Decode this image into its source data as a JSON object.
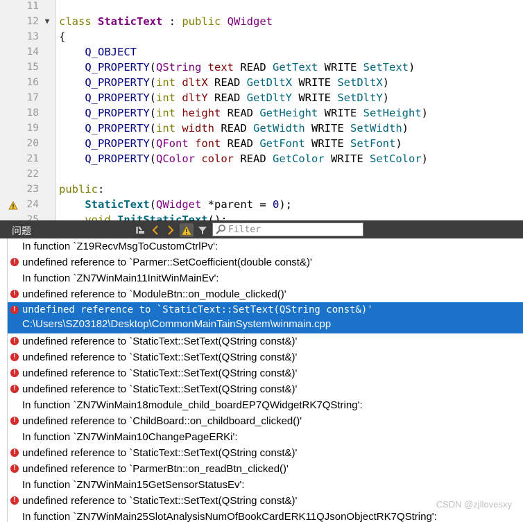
{
  "editor": {
    "lines": [
      {
        "n": "11",
        "tokens": []
      },
      {
        "n": "12",
        "fold": "▼",
        "tokens": [
          [
            "t-kw",
            "class "
          ],
          [
            "t-cls",
            "StaticText"
          ],
          [
            "t-plain",
            " : "
          ],
          [
            "t-kw",
            "public "
          ],
          [
            "t-type",
            "QWidget"
          ]
        ]
      },
      {
        "n": "13",
        "tokens": [
          [
            "t-punc",
            "{"
          ]
        ]
      },
      {
        "n": "14",
        "tokens": [
          [
            "t-plain",
            "    "
          ],
          [
            "t-macro",
            "Q_OBJECT"
          ]
        ]
      },
      {
        "n": "15",
        "tokens": [
          [
            "t-plain",
            "    "
          ],
          [
            "t-macro",
            "Q_PROPERTY"
          ],
          [
            "t-punc",
            "("
          ],
          [
            "t-type",
            "QString"
          ],
          [
            "t-plain",
            " "
          ],
          [
            "t-mem",
            "text"
          ],
          [
            "t-plain",
            " READ "
          ],
          [
            "t-acc",
            "GetText"
          ],
          [
            "t-plain",
            " WRITE "
          ],
          [
            "t-acc",
            "SetText"
          ],
          [
            "t-punc",
            ")"
          ]
        ]
      },
      {
        "n": "16",
        "tokens": [
          [
            "t-plain",
            "    "
          ],
          [
            "t-macro",
            "Q_PROPERTY"
          ],
          [
            "t-punc",
            "("
          ],
          [
            "t-prim",
            "int"
          ],
          [
            "t-plain",
            " "
          ],
          [
            "t-mem",
            "dltX"
          ],
          [
            "t-plain",
            " READ "
          ],
          [
            "t-acc",
            "GetDltX"
          ],
          [
            "t-plain",
            " WRITE "
          ],
          [
            "t-acc",
            "SetDltX"
          ],
          [
            "t-punc",
            ")"
          ]
        ]
      },
      {
        "n": "17",
        "tokens": [
          [
            "t-plain",
            "    "
          ],
          [
            "t-macro",
            "Q_PROPERTY"
          ],
          [
            "t-punc",
            "("
          ],
          [
            "t-prim",
            "int"
          ],
          [
            "t-plain",
            " "
          ],
          [
            "t-mem",
            "dltY"
          ],
          [
            "t-plain",
            " READ "
          ],
          [
            "t-acc",
            "GetDltY"
          ],
          [
            "t-plain",
            " WRITE "
          ],
          [
            "t-acc",
            "SetDltY"
          ],
          [
            "t-punc",
            ")"
          ]
        ]
      },
      {
        "n": "18",
        "tokens": [
          [
            "t-plain",
            "    "
          ],
          [
            "t-macro",
            "Q_PROPERTY"
          ],
          [
            "t-punc",
            "("
          ],
          [
            "t-prim",
            "int"
          ],
          [
            "t-plain",
            " "
          ],
          [
            "t-mem",
            "height"
          ],
          [
            "t-plain",
            " READ "
          ],
          [
            "t-acc",
            "GetHeight"
          ],
          [
            "t-plain",
            " WRITE "
          ],
          [
            "t-acc",
            "SetHeight"
          ],
          [
            "t-punc",
            ")"
          ]
        ]
      },
      {
        "n": "19",
        "tokens": [
          [
            "t-plain",
            "    "
          ],
          [
            "t-macro",
            "Q_PROPERTY"
          ],
          [
            "t-punc",
            "("
          ],
          [
            "t-prim",
            "int"
          ],
          [
            "t-plain",
            " "
          ],
          [
            "t-mem",
            "width"
          ],
          [
            "t-plain",
            " READ "
          ],
          [
            "t-acc",
            "GetWidth"
          ],
          [
            "t-plain",
            " WRITE "
          ],
          [
            "t-acc",
            "SetWidth"
          ],
          [
            "t-punc",
            ")"
          ]
        ]
      },
      {
        "n": "20",
        "tokens": [
          [
            "t-plain",
            "    "
          ],
          [
            "t-macro",
            "Q_PROPERTY"
          ],
          [
            "t-punc",
            "("
          ],
          [
            "t-type",
            "QFont"
          ],
          [
            "t-plain",
            " "
          ],
          [
            "t-mem",
            "font"
          ],
          [
            "t-plain",
            " READ "
          ],
          [
            "t-acc",
            "GetFont"
          ],
          [
            "t-plain",
            " WRITE "
          ],
          [
            "t-acc",
            "SetFont"
          ],
          [
            "t-punc",
            ")"
          ]
        ]
      },
      {
        "n": "21",
        "tokens": [
          [
            "t-plain",
            "    "
          ],
          [
            "t-macro",
            "Q_PROPERTY"
          ],
          [
            "t-punc",
            "("
          ],
          [
            "t-type",
            "QColor"
          ],
          [
            "t-plain",
            " "
          ],
          [
            "t-mem",
            "color"
          ],
          [
            "t-plain",
            " READ "
          ],
          [
            "t-acc",
            "GetColor"
          ],
          [
            "t-plain",
            " WRITE "
          ],
          [
            "t-acc",
            "SetColor"
          ],
          [
            "t-punc",
            ")"
          ]
        ]
      },
      {
        "n": "22",
        "tokens": []
      },
      {
        "n": "23",
        "tokens": [
          [
            "t-kw",
            "public"
          ],
          [
            "t-punc",
            ":"
          ]
        ]
      },
      {
        "n": "24",
        "warn": true,
        "tokens": [
          [
            "t-plain",
            "    "
          ],
          [
            "t-ctor",
            "StaticText"
          ],
          [
            "t-punc",
            "("
          ],
          [
            "t-type",
            "QWidget"
          ],
          [
            "t-plain",
            " *"
          ],
          [
            "t-plain",
            "parent = "
          ],
          [
            "t-num",
            "0"
          ],
          [
            "t-punc",
            ");"
          ]
        ]
      },
      {
        "n": "25",
        "tokens": [
          [
            "t-plain",
            "    "
          ],
          [
            "t-kw",
            "void "
          ],
          [
            "t-ctor",
            "InitStaticText"
          ],
          [
            "t-punc",
            "();"
          ]
        ]
      }
    ]
  },
  "toolbar": {
    "title": "问题",
    "filter_placeholder": "Filter"
  },
  "issues": [
    {
      "type": "context",
      "text": "In function `Z19RecvMsgToCustomCtrlPv':"
    },
    {
      "type": "error",
      "text": "undefined reference to `Parmer::SetCoefficient(double const&)'"
    },
    {
      "type": "context",
      "text": "In function `ZN7WinMain11InitWinMainEv':"
    },
    {
      "type": "error",
      "text": "undefined reference to `ModuleBtn::on_module_clicked()'"
    },
    {
      "type": "selected",
      "text": "undefined reference to `StaticText::SetText(QString const&)'",
      "path": "C:\\Users\\SZ03182\\Desktop\\CommonMainTainSystem\\winmain.cpp"
    },
    {
      "type": "error",
      "text": "undefined reference to `StaticText::SetText(QString const&)'"
    },
    {
      "type": "error",
      "text": "undefined reference to `StaticText::SetText(QString const&)'"
    },
    {
      "type": "error",
      "text": "undefined reference to `StaticText::SetText(QString const&)'"
    },
    {
      "type": "error",
      "text": "undefined reference to `StaticText::SetText(QString const&)'"
    },
    {
      "type": "context",
      "text": "In function `ZN7WinMain18module_child_boardEP7QWidgetRK7QString':"
    },
    {
      "type": "error",
      "text": "undefined reference to `ChildBoard::on_childboard_clicked()'"
    },
    {
      "type": "context",
      "text": "In function `ZN7WinMain10ChangePageERKi':"
    },
    {
      "type": "error",
      "text": "undefined reference to `StaticText::SetText(QString const&)'"
    },
    {
      "type": "error",
      "text": "undefined reference to `ParmerBtn::on_readBtn_clicked()'"
    },
    {
      "type": "context",
      "text": "In function `ZN7WinMain15GetSensorStatusEv':"
    },
    {
      "type": "error",
      "text": "undefined reference to `StaticText::SetText(QString const&)'"
    },
    {
      "type": "context",
      "text": "In function `ZN7WinMain25SlotAnalysisNumOfBookCardERK11QJsonObjectRK7QString':"
    }
  ],
  "watermark": "CSDN @zjllovesxy"
}
